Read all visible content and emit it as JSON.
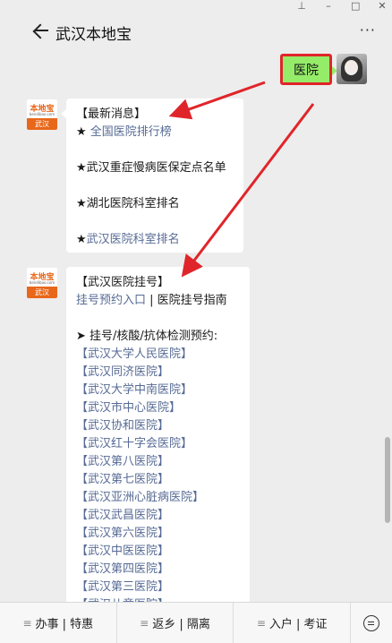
{
  "window": {
    "icons": [
      "pin-icon",
      "minimize-icon",
      "maximize-icon",
      "close-icon"
    ],
    "glyphs": [
      "⊥",
      "–",
      "□",
      "✕"
    ]
  },
  "header": {
    "title": "武汉本地宝",
    "more": "···"
  },
  "user_message": {
    "text": "医院",
    "highlight_color": "#e0252a",
    "bubble_color": "#95ec69"
  },
  "bot": {
    "avatar_top": "本地宝",
    "avatar_mid": "bendibao.com",
    "avatar_bottom": "武汉"
  },
  "message1": {
    "heading": "【最新消息】",
    "items": [
      {
        "prefix": "★ ",
        "text": "全国医院排行榜"
      },
      {
        "prefix": "★",
        "text": "武汉重症慢病医保定点名单"
      },
      {
        "prefix": "★",
        "text": "湖北医院科室排名"
      },
      {
        "prefix": "★",
        "text": "武汉医院科室排名"
      }
    ]
  },
  "message2": {
    "heading": "【武汉医院挂号】",
    "link1": "挂号预约入口",
    "sep": " | ",
    "link2": "医院挂号指南",
    "section": "➤ 挂号/核酸/抗体检测预约:",
    "hospitals": [
      "【武汉大学人民医院】",
      "【武汉同济医院】",
      "【武汉大学中南医院】",
      "【武汉市中心医院】",
      "【武汉协和医院】",
      "【武汉红十字会医院】",
      "【武汉第八医院】",
      "【武汉第七医院】",
      "【武汉亚洲心脏病医院】",
      "【武汉武昌医院】",
      "【武汉第六医院】",
      "【武汉中医医院】",
      "【武汉第四医院】",
      "【武汉第三医院】",
      "【武汉儿童医院】"
    ]
  },
  "menu": {
    "items": [
      "办事 | 特惠",
      "返乡 | 隔离",
      "入户 | 考证"
    ],
    "hamburger": "≡",
    "keyboard": "keyboard-icon"
  }
}
